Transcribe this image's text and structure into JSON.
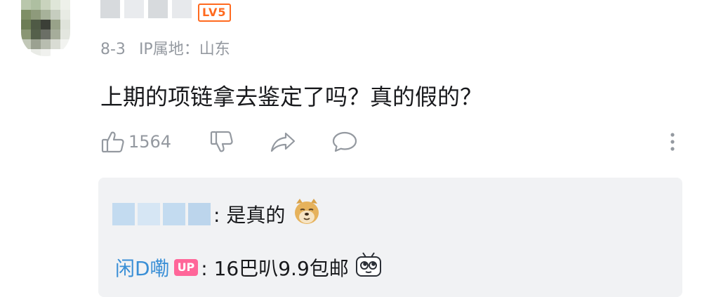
{
  "comment": {
    "level": "LV5",
    "date": "8-3",
    "ip_location": "IP属地：山东",
    "text": "上期的项链拿去鉴定了吗？真的假的？"
  },
  "actions": {
    "like_count": "1564",
    "like_icon": "thumb-up-icon",
    "dislike_icon": "thumb-down-icon",
    "share_icon": "share-icon",
    "reply_icon": "comment-icon",
    "more_icon": "more-vertical-icon"
  },
  "replies": [
    {
      "author": "",
      "text": ": 是真的",
      "emoji": "doge-emoji"
    },
    {
      "author": "闲D嘞",
      "badge": "UP",
      "text": ": 16巴叭9.9包邮",
      "emoji": "tv-emoji"
    }
  ],
  "colors": {
    "level_badge": "#ff6a1f",
    "meta_text": "#9499a0",
    "reply_bg": "#f1f2f4",
    "up_badge": "#ff6699",
    "author_link": "#3a8fd6"
  }
}
